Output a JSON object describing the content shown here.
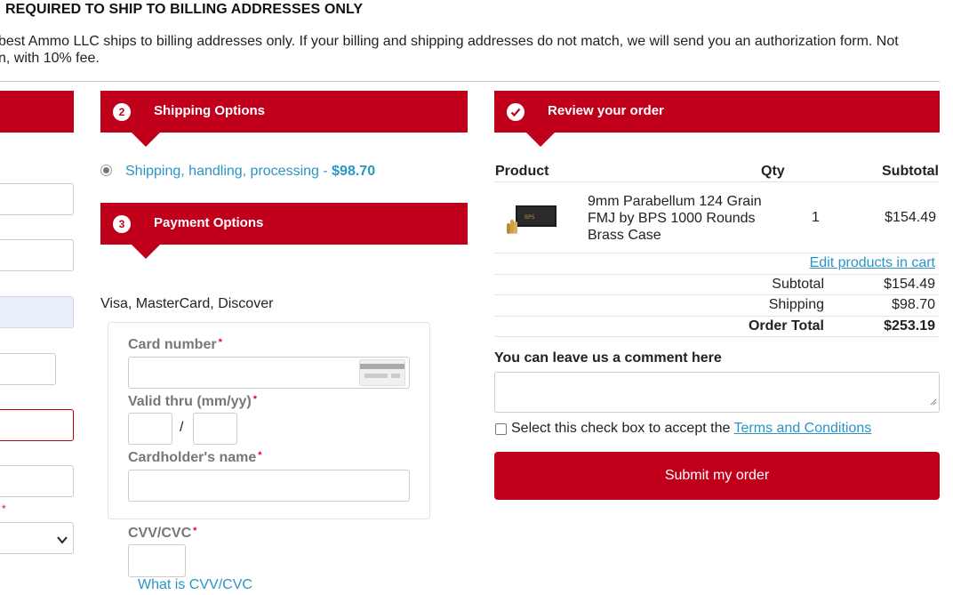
{
  "notice": {
    "title": "REQUIRED TO SHIP TO BILLING ADDRESSES ONLY",
    "text": "best Ammo LLC ships to billing addresses only. If your billing and shipping addresses do not match, we will send you an authorization form. Not",
    "text2": "n, with 10% fee."
  },
  "shipping": {
    "step": "2",
    "title": "Shipping Options",
    "option_label": "Shipping, handling, processing - ",
    "option_price": "$98.70"
  },
  "payment": {
    "step": "3",
    "title": "Payment Options",
    "method": "Visa, MasterCard, Discover",
    "card_number_label": "Card number",
    "valid_thru_label": "Valid thru (mm/yy)",
    "separator": "/",
    "cardholder_label": "Cardholder's name",
    "cvv_label": "CVV/CVC",
    "cvv_link": "What is CVV/CVC",
    "required_mark": "*"
  },
  "review": {
    "title": "Review your order",
    "col_product": "Product",
    "col_qty": "Qty",
    "col_subtotal": "Subtotal",
    "items": [
      {
        "name_line1": "9mm Parabellum 124 Grain",
        "name_line2": "FMJ by BPS 1000 Rounds",
        "name_line3": "Brass Case",
        "qty": "1",
        "subtotal": "$154.49"
      }
    ],
    "edit_link": "Edit products in cart",
    "subtotal_label": "Subtotal",
    "subtotal_value": "$154.49",
    "shipping_label": "Shipping",
    "shipping_value": "$98.70",
    "total_label": "Order Total",
    "total_value": "$253.19",
    "comment_label": "You can leave us a comment here",
    "terms_prefix": "Select this check box to accept the ",
    "terms_link": "Terms and Conditions",
    "submit_label": "Submit my order"
  },
  "left_column": {
    "required_mark": "*"
  },
  "colors": {
    "brand_red": "#c0001a",
    "link_blue": "#2a95c5"
  }
}
